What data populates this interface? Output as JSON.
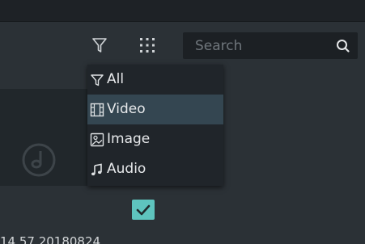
{
  "search": {
    "placeholder": "Search"
  },
  "filter_menu": {
    "items": [
      {
        "label": "All",
        "icon": "filter-icon",
        "selected": false
      },
      {
        "label": "Video",
        "icon": "film-icon",
        "selected": true
      },
      {
        "label": "Image",
        "icon": "image-icon",
        "selected": false
      },
      {
        "label": "Audio",
        "icon": "music-note-icon",
        "selected": false
      }
    ]
  },
  "media_item": {
    "filename": "14 57 20180824",
    "checked": true
  },
  "colors": {
    "background": "#2b3136",
    "top_band": "#1e2226",
    "menu_background": "#20252a",
    "menu_selected": "#344651",
    "accent_checkbox": "#5ec4be",
    "search_background": "#1c2024"
  }
}
